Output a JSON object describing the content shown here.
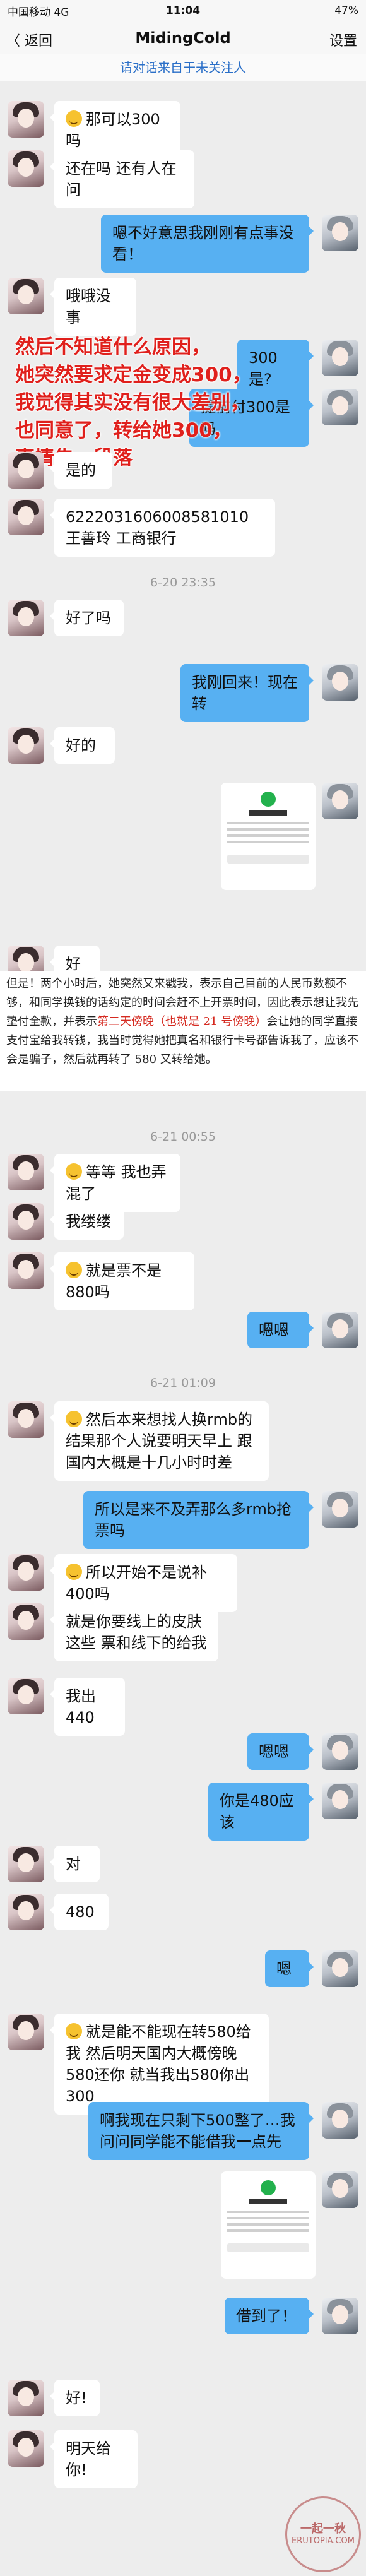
{
  "status": {
    "carrier": "中国移动  4G",
    "time": "11:04",
    "battery": "47%"
  },
  "nav": {
    "back": "〈 返回",
    "title": "MidingCold",
    "settings": "设置"
  },
  "notice": "请对话来自于未关注人",
  "messages": {
    "m1": "那可以300吗",
    "m2": "还在吗 还有人在问",
    "m3": "嗯不好意思我刚刚有点事没看！",
    "m4": "哦哦没事",
    "m5": "300是?",
    "m6": "提前付300是吗",
    "m7": "是的",
    "m8": "6222031606008581010  王善玲  工商银行",
    "m9": "好了吗",
    "m10": "我刚回来！现在转",
    "m11": "好的",
    "m12": "好",
    "m13": "等等 我也弄混了",
    "m14": "我缕缕",
    "m15": "就是票不是880吗",
    "m16": "嗯嗯",
    "m17": "然后本来想找人换rmb的 结果那个人说要明天早上 跟国内大概是十几小时时差",
    "m18": "所以是来不及弄那么多rmb抢票吗",
    "m19": "所以开始不是说补400吗",
    "m20": "就是你要线上的皮肤这些 票和线下的给我",
    "m21": "我出440",
    "m22": "嗯嗯",
    "m23": "你是480应该",
    "m24": "对",
    "m25": "480",
    "m26": "嗯",
    "m27": "就是能不能现在转580给我 然后明天国内大概傍晚 580还你 就当我出580你出300",
    "m28": "啊我现在只剩下500整了…我问问同学能不能借我一点先",
    "m29": "借到了！",
    "m30": "好!",
    "m31": "明天给你!"
  },
  "times": {
    "t1": "6-20 23:35",
    "t2": "6-21 00:55",
    "t3": "6-21 01:09"
  },
  "overlay_text": "然后不知道什么原因，\n她突然要求定金变成300，\n我觉得其实没有很大差别，\n也同意了，转给她300，\n事情告一段落",
  "paper": {
    "p1": "但是！两个小时后，她突然又来戳我，表示自己目前的人民币数额不够，和同学换钱的话约定的时间会赶不上开票时间，因此表示想让我先垫付全款，并表示",
    "p_red": "第二天傍晚（也就是 21 号傍晚）",
    "p2": "会让她的同学直接支付宝给我转钱，我当时觉得她把真名和银行卡号都告诉我了，应该不会是骗子，然后就再转了 580 又转给她。"
  },
  "watermark": {
    "top": "一起一秋",
    "site": "ERUTOPIA.COM"
  }
}
